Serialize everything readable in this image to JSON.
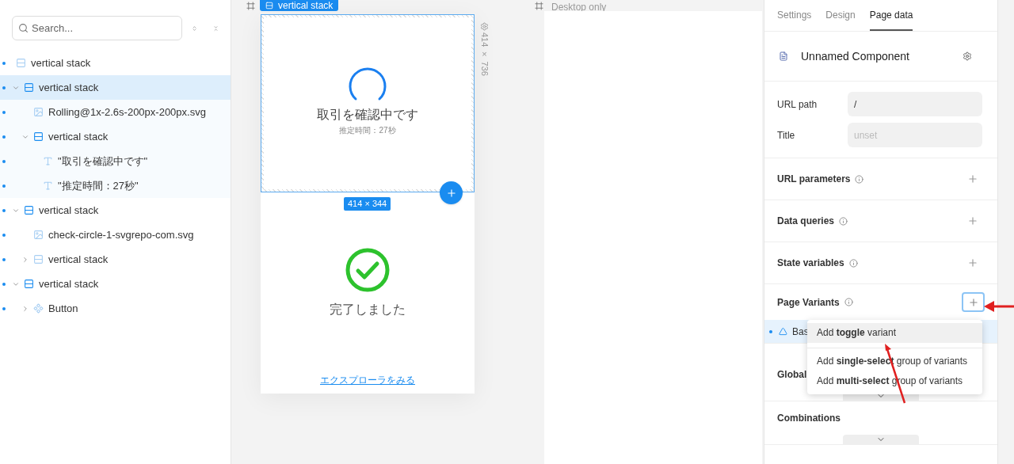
{
  "outline": {
    "search": {
      "placeholder": "Search..."
    },
    "tree": [
      {
        "kind": "stack",
        "label": "vertical stack",
        "selected": false,
        "children": [
          {
            "kind": "stack",
            "label": "vertical stack",
            "selected": true,
            "expanded": true,
            "children": [
              {
                "kind": "image",
                "label": "Rolling@1x-2.6s-200px-200px.svg",
                "selected": false
              },
              {
                "kind": "stack",
                "label": "vertical stack",
                "selected": false,
                "expanded": true,
                "children": [
                  {
                    "kind": "text",
                    "label": "\"取引を確認中です\"",
                    "selected": false
                  },
                  {
                    "kind": "text",
                    "label": "\"推定時間：27秒\"",
                    "selected": false
                  }
                ]
              }
            ]
          },
          {
            "kind": "stack",
            "label": "vertical stack",
            "selected": false,
            "expanded": true,
            "children": [
              {
                "kind": "image",
                "label": "check-circle-1-svgrepo-com.svg",
                "selected": false
              },
              {
                "kind": "stack",
                "label": "vertical stack",
                "selected": false,
                "expanded": false
              }
            ]
          },
          {
            "kind": "stack",
            "label": "vertical stack",
            "selected": false,
            "expanded": true,
            "children": [
              {
                "kind": "component",
                "label": "Button",
                "selected": false,
                "expanded": false
              }
            ]
          }
        ]
      }
    ]
  },
  "canvas": {
    "mobile_frame": {
      "label": "vertical stack",
      "size": "414 × 736",
      "selection_size": "414 × 344",
      "loading": {
        "title": "取引を確認中です",
        "subtitle": "推定時間：27秒"
      },
      "done": {
        "title": "完了しました",
        "link": "エクスプローラをみる"
      }
    },
    "desktop_frame": {
      "label": "Desktop only"
    }
  },
  "inspector": {
    "tabs": [
      {
        "label": "Settings",
        "selected": false
      },
      {
        "label": "Design",
        "selected": false
      },
      {
        "label": "Page data",
        "selected": true
      }
    ],
    "component_name": "Unnamed Component",
    "fields": [
      {
        "label": "URL path",
        "value": "/"
      },
      {
        "label": "Title",
        "placeholder": "unset"
      }
    ],
    "sections": [
      {
        "title": "URL parameters"
      },
      {
        "title": "Data queries"
      },
      {
        "title": "State variables"
      }
    ],
    "page_variants": {
      "title": "Page Variants",
      "variant": "Bas",
      "menu": [
        {
          "text": "Add **toggle** variant",
          "selected": true
        },
        {
          "text": "Add **single-select** group of variants",
          "selected": false
        },
        {
          "text": "Add **multi-select** group of variants",
          "selected": false
        }
      ]
    },
    "collapsed_sections": [
      {
        "title": "Global"
      },
      {
        "title": "Combinations"
      }
    ]
  }
}
